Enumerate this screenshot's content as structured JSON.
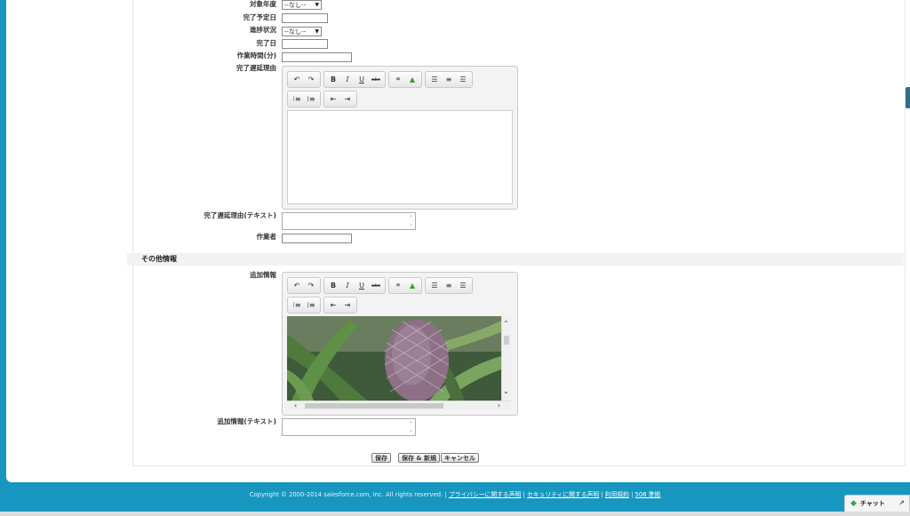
{
  "form": {
    "fields": [
      {
        "label": "対象年度",
        "type": "select",
        "value": "--なし--"
      },
      {
        "label": "完了予定日",
        "type": "date"
      },
      {
        "label": "進捗状況",
        "type": "select",
        "value": "--なし--"
      },
      {
        "label": "完了日",
        "type": "date"
      },
      {
        "label": "作業時間(分)",
        "type": "text"
      },
      {
        "label": "完了遅延理由",
        "type": "richtext"
      },
      {
        "label": "完了遅延理由(テキスト)",
        "type": "textarea"
      },
      {
        "label": "作業者",
        "type": "text"
      }
    ]
  },
  "other_section": {
    "title": "その他情報",
    "fields": [
      {
        "label": "追加情報",
        "type": "richtext",
        "content": "image"
      },
      {
        "label": "追加情報(テキスト)",
        "type": "textarea"
      }
    ]
  },
  "toolbar": {
    "bold": "B",
    "italic": "I",
    "underline": "U",
    "strike": "abc",
    "icons": [
      "undo-icon",
      "redo-icon",
      "bold-icon",
      "italic-icon",
      "underline-icon",
      "strikethrough-icon",
      "link-icon",
      "image-icon",
      "align-left-icon",
      "align-center-icon",
      "align-right-icon",
      "bullet-list-icon",
      "numbered-list-icon",
      "outdent-icon",
      "indent-icon"
    ]
  },
  "buttons": {
    "save": "保存",
    "save_new": "保存 & 新規",
    "cancel": "キャンセル"
  },
  "footer": {
    "copyright": "Copyright © 2000-2014 salesforce.com, inc. All rights reserved.",
    "links": [
      "プライバシーに関する声明",
      "セキュリティに関する声明",
      "利用規約",
      "508 準拠"
    ]
  },
  "chat": {
    "label": "チャット"
  },
  "colors": {
    "background": "#1797c0",
    "section_header": "#f2f2f2",
    "image_icon": "#3a9b2c",
    "chat_icon": "#3aa24a"
  }
}
